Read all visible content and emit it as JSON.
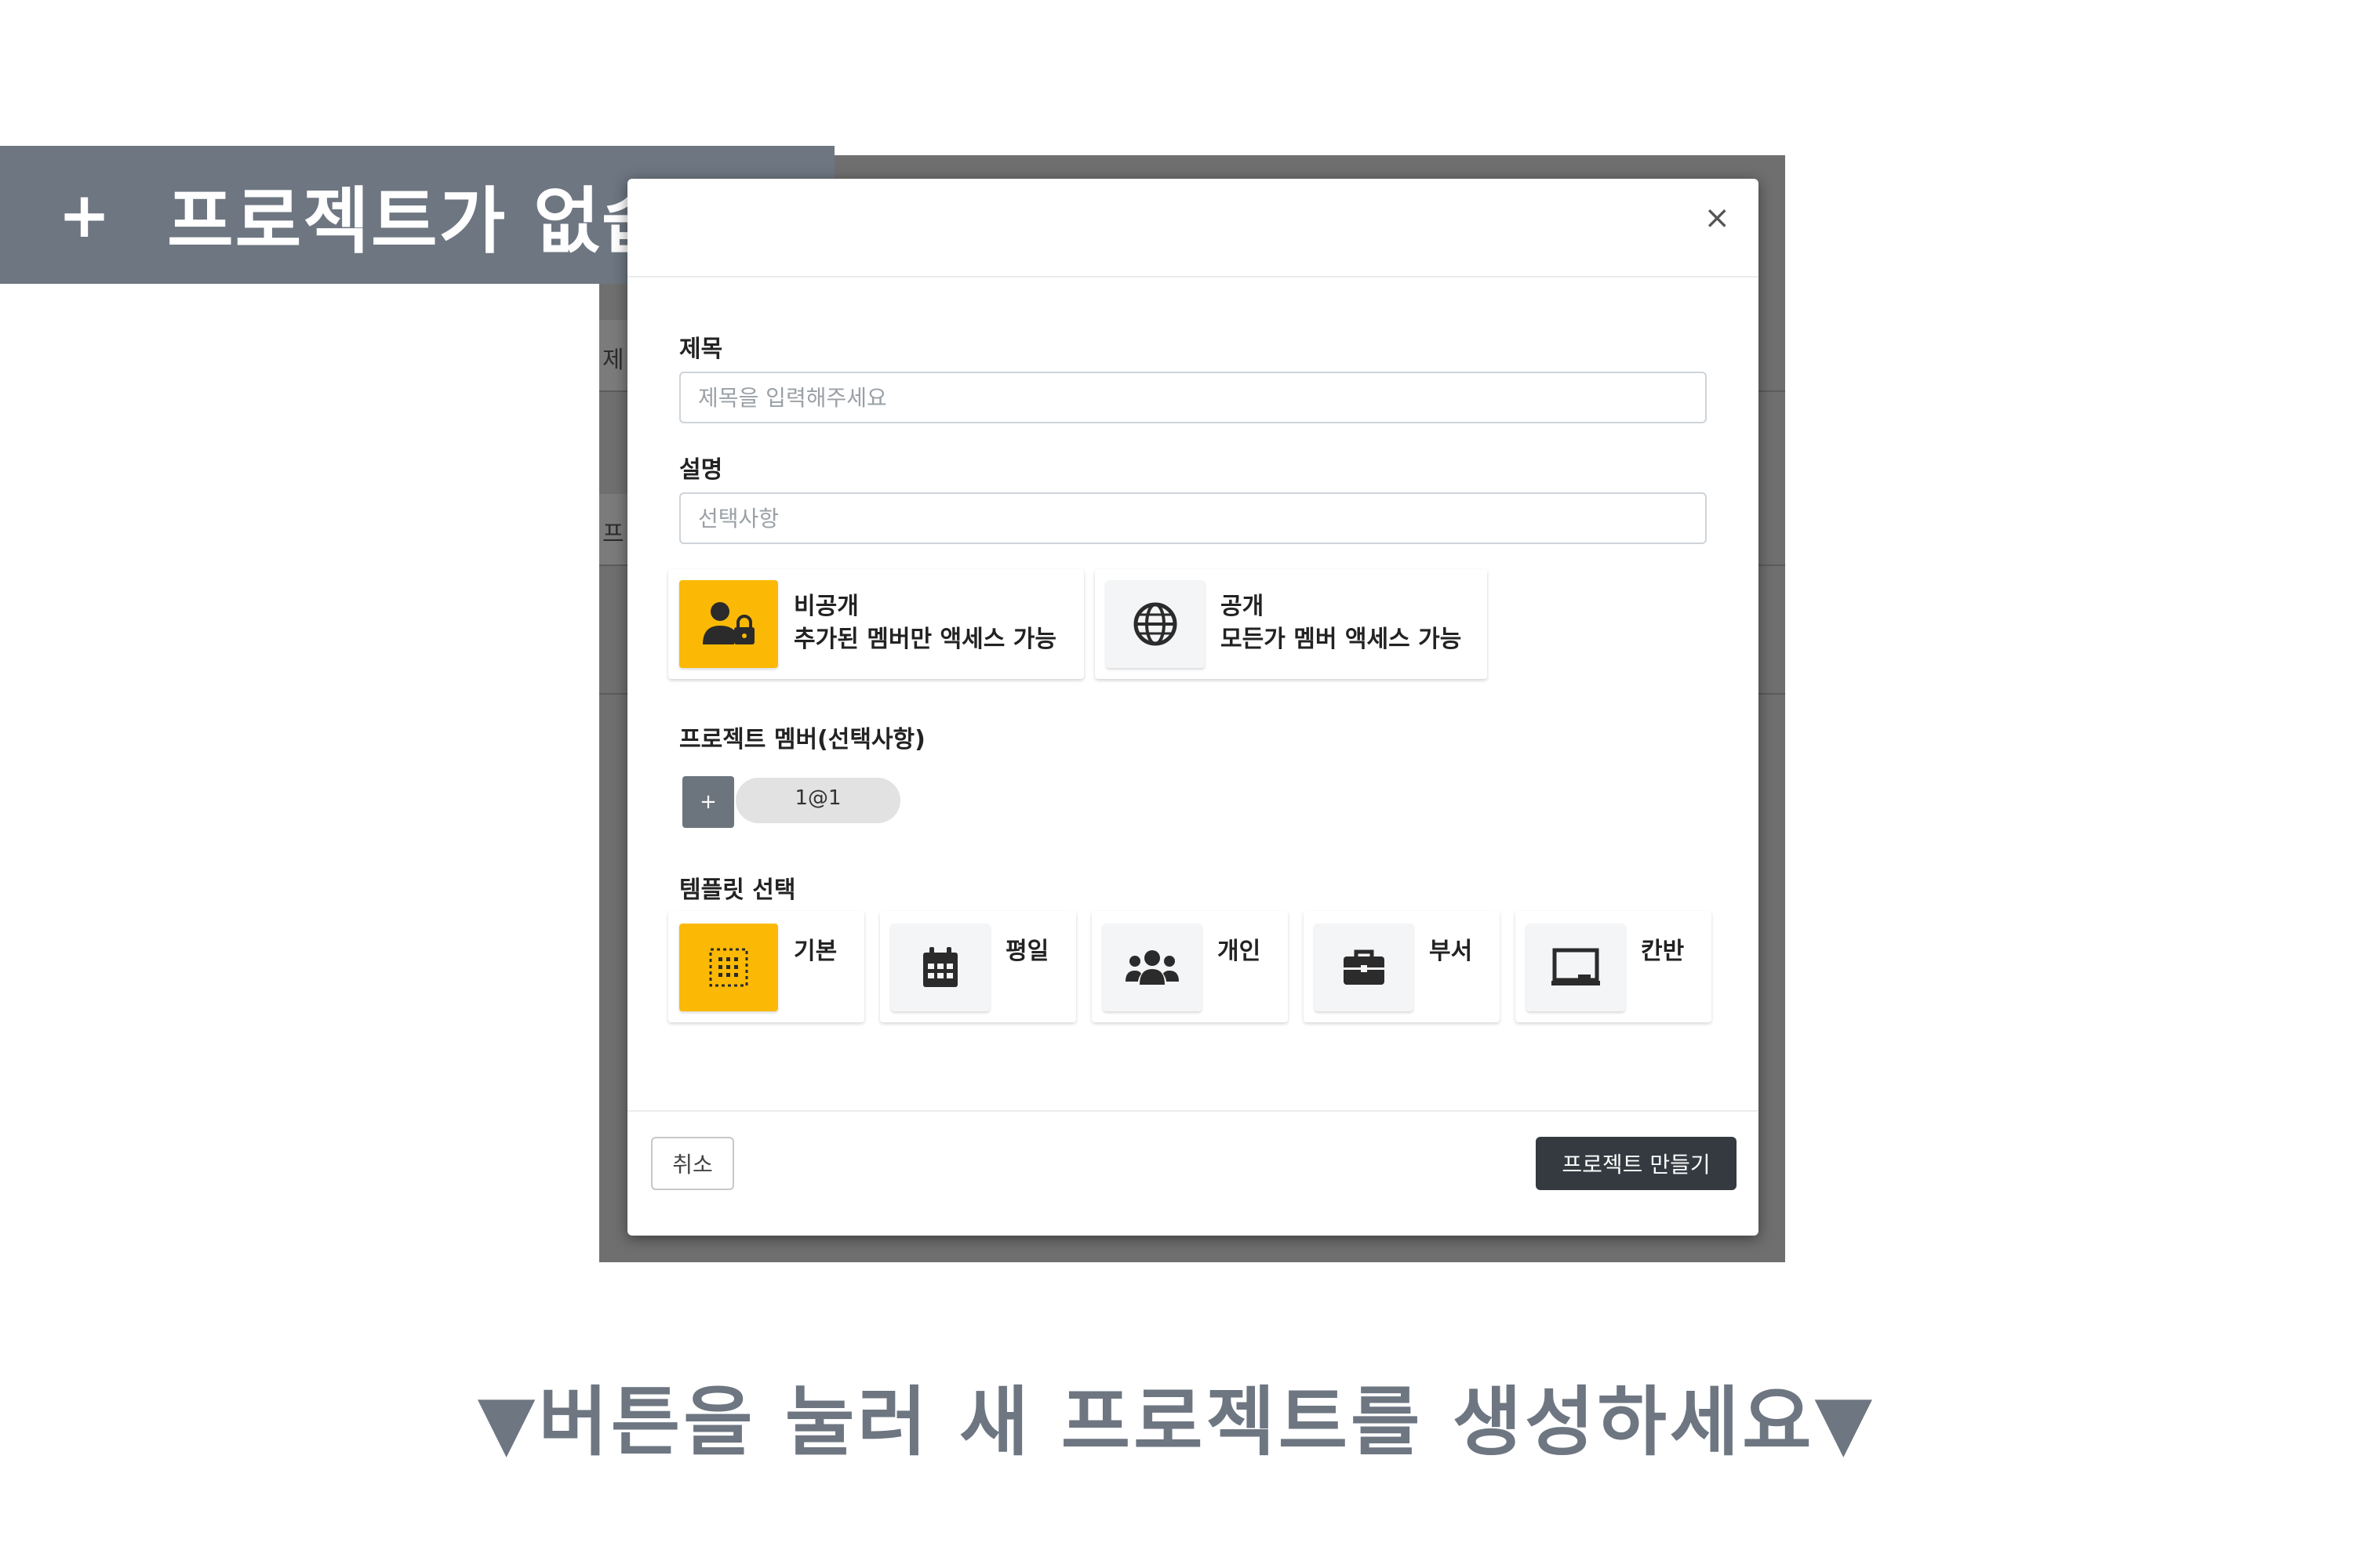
{
  "banner": {
    "plus": "+",
    "text": "프로젝트가 없습니다."
  },
  "background": {
    "row1_text": "제",
    "row2_text": "프"
  },
  "modal": {
    "close": "×",
    "title_label": "제목",
    "title_placeholder": "제목을 입력해주세요",
    "desc_label": "설명",
    "desc_placeholder": "선택사항",
    "visibility": [
      {
        "title": "비공개",
        "desc": "추가된 멤버만 액세스 가능",
        "icon": "user-lock-icon",
        "selected": true
      },
      {
        "title": "공개",
        "desc": "모든가 멤버 액세스 가능",
        "icon": "globe-icon",
        "selected": false
      }
    ],
    "members_label": "프로젝트 멤버(선택사항)",
    "member_add": "+",
    "members": [
      "1@1"
    ],
    "template_label": "템플릿 선택",
    "templates": [
      {
        "label": "기본",
        "icon": "grid-icon",
        "selected": true
      },
      {
        "label": "평일",
        "icon": "calendar-icon",
        "selected": false
      },
      {
        "label": "개인",
        "icon": "users-icon",
        "selected": false
      },
      {
        "label": "부서",
        "icon": "briefcase-icon",
        "selected": false
      },
      {
        "label": "칸반",
        "icon": "chalkboard-icon",
        "selected": false
      }
    ],
    "cancel": "취소",
    "create": "프로젝트 만들기"
  },
  "caption": "▼버튼을 눌러 새 프로젝트를 생성하세요▼",
  "colors": {
    "accent": "#fbb905",
    "dark": "#343a40",
    "banner": "#6d7681"
  }
}
